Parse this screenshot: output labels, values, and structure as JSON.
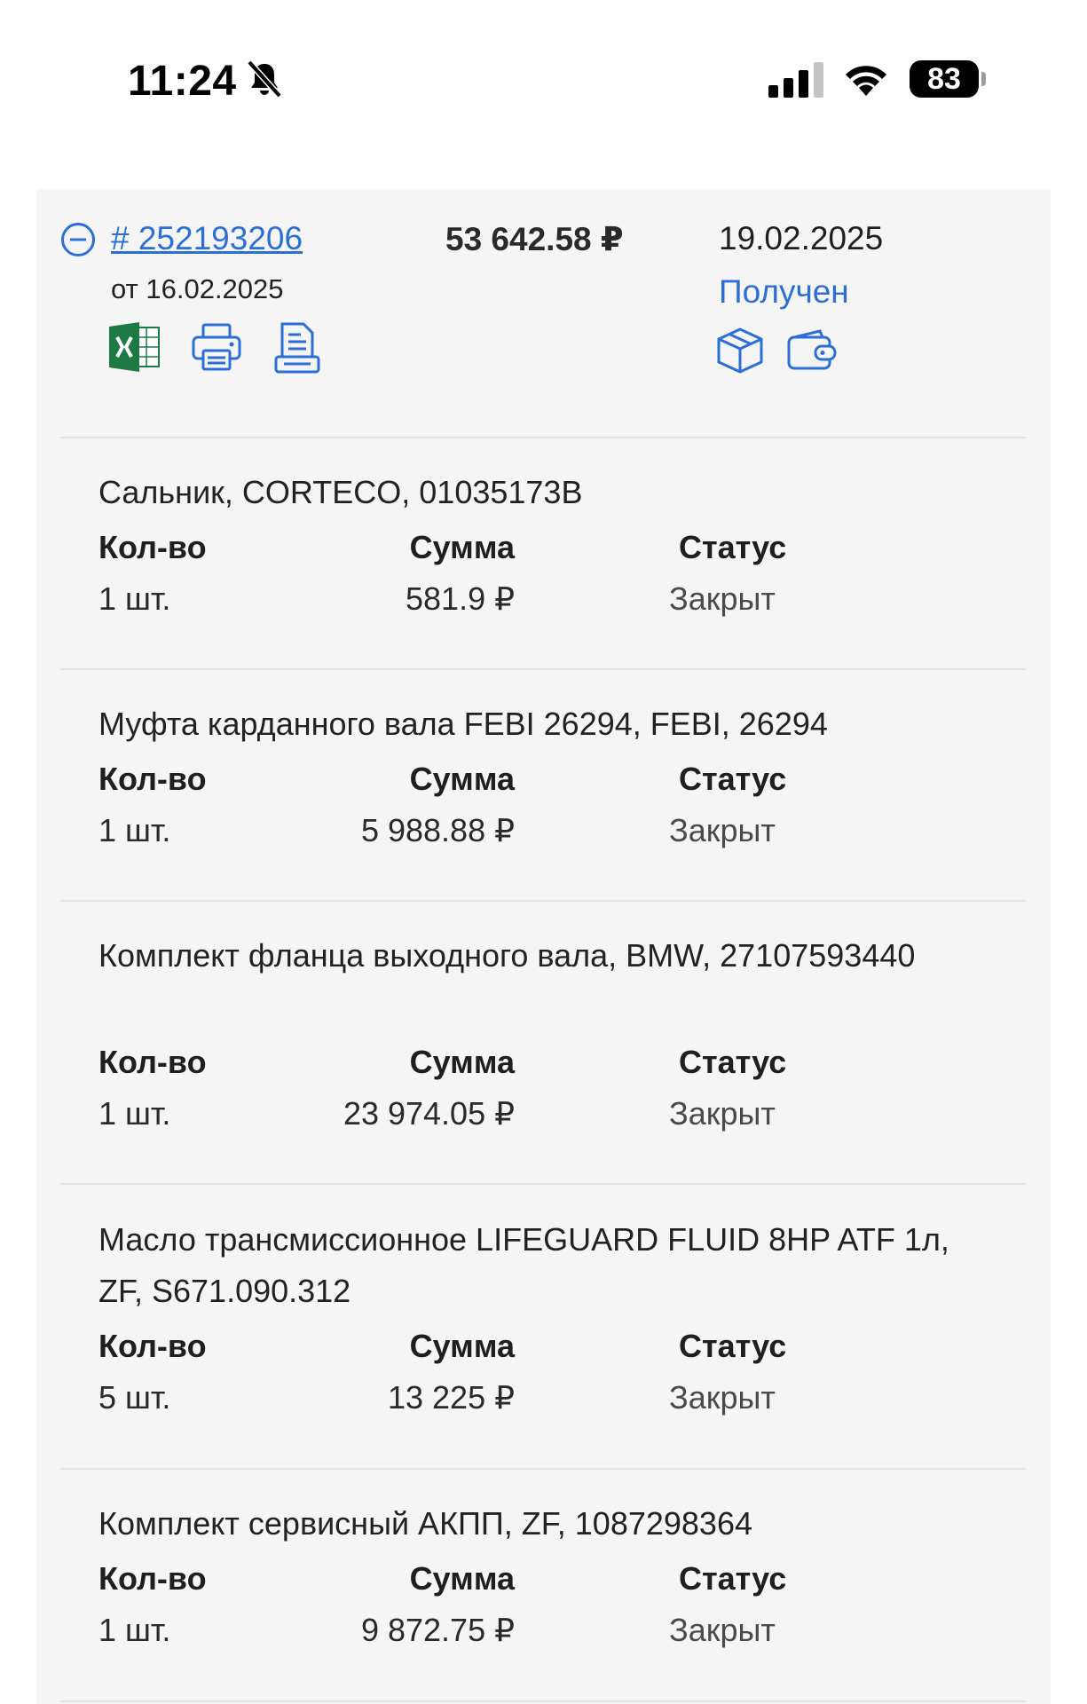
{
  "status_bar": {
    "time": "11:24",
    "battery": "83"
  },
  "order": {
    "number": "# 252193206",
    "date": "от 16.02.2025",
    "total": "53 642.58 ₽",
    "delivery_date": "19.02.2025",
    "status": "Получен",
    "status_color": "#2b6fd6"
  },
  "columns": {
    "qty": "Кол-во",
    "sum": "Сумма",
    "status": "Статус"
  },
  "items": [
    {
      "name": "Сальник, CORTECO, 01035173B",
      "qty": "1 шт.",
      "sum": "581.9 ₽",
      "status": "Закрыт"
    },
    {
      "name": "Муфта карданного вала FEBI 26294, FEBI, 26294",
      "qty": "1 шт.",
      "sum": "5 988.88 ₽",
      "status": "Закрыт"
    },
    {
      "name": "Комплект фланца выходного вала, BMW, 27107593440",
      "qty": "1 шт.",
      "sum": "23 974.05 ₽",
      "status": "Закрыт"
    },
    {
      "name": "Масло трансмиссионное LIFEGUARD FLUID 8HP ATF 1л, ZF, S671.090.312",
      "qty": "5 шт.",
      "sum": "13 225 ₽",
      "status": "Закрыт"
    },
    {
      "name": "Комплект сервисный АКПП, ZF, 1087298364",
      "qty": "1 шт.",
      "sum": "9 872.75 ₽",
      "status": "Закрыт"
    }
  ]
}
